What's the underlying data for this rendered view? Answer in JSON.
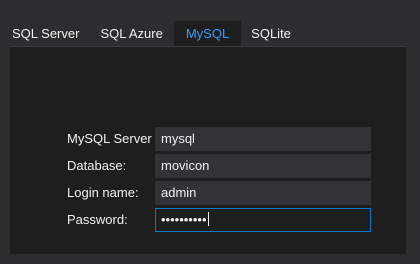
{
  "tabs": [
    {
      "label": "SQL Server"
    },
    {
      "label": "SQL Azure"
    },
    {
      "label": "MySQL"
    },
    {
      "label": "SQLite"
    }
  ],
  "active_tab": "MySQL",
  "form": {
    "server_label": "MySQL Server",
    "server_value": "mysql",
    "database_label": "Database:",
    "database_value": "movicon",
    "login_label": "Login name:",
    "login_value": "admin",
    "password_label": "Password:",
    "password_mask": "••••••••••"
  },
  "colors": {
    "background": "#2d2d30",
    "panel": "#1e1e1e",
    "field": "#333337",
    "text": "#f1f1f1",
    "accent": "#3399ff",
    "focus_border": "#007acc"
  }
}
